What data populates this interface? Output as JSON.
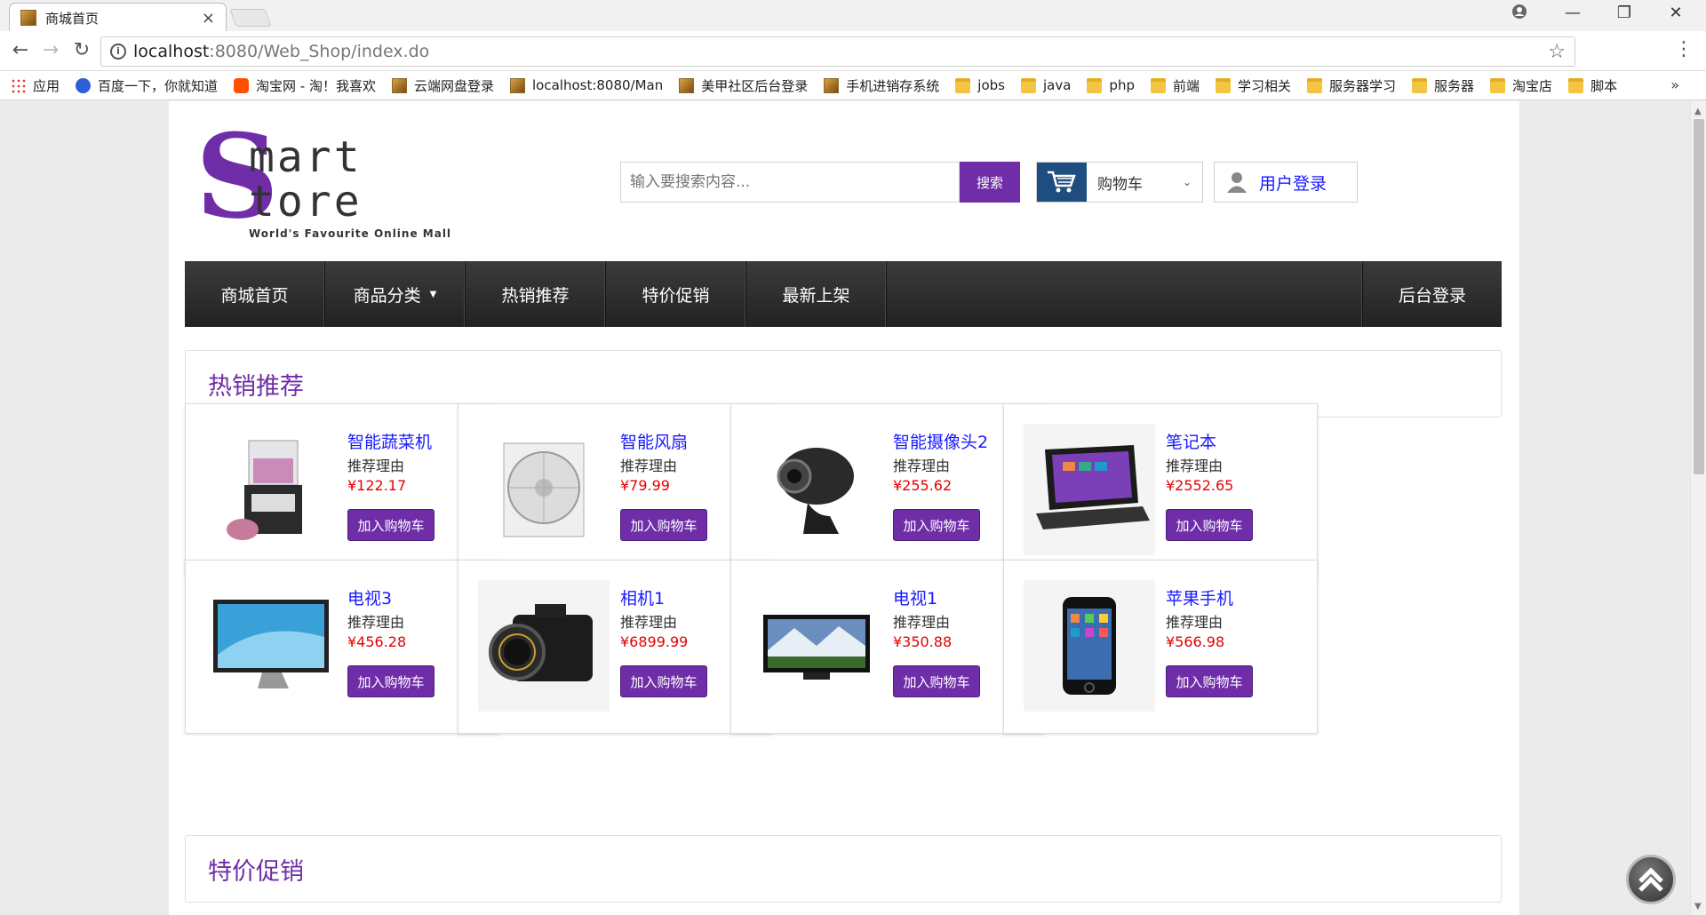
{
  "browser": {
    "tab_title": "商城首页",
    "tab_close": "×",
    "url_host": "localhost",
    "url_rest": ":8080/Web_Shop/index.do",
    "bookmarks": [
      {
        "label": "应用",
        "icon": "apps-icon"
      },
      {
        "label": "百度一下，你就知道",
        "icon": "baidu-icon"
      },
      {
        "label": "淘宝网 - 淘！我喜欢",
        "icon": "taobao-icon"
      },
      {
        "label": "云端网盘登录",
        "icon": "page-icon"
      },
      {
        "label": "localhost:8080/Man",
        "icon": "page-icon"
      },
      {
        "label": "美甲社区后台登录",
        "icon": "page-icon"
      },
      {
        "label": "手机进销存系统",
        "icon": "page-icon"
      },
      {
        "label": "jobs",
        "icon": "folder-icon"
      },
      {
        "label": "java",
        "icon": "folder-icon"
      },
      {
        "label": "php",
        "icon": "folder-icon"
      },
      {
        "label": "前端",
        "icon": "folder-icon"
      },
      {
        "label": "学习相关",
        "icon": "folder-icon"
      },
      {
        "label": "服务器学习",
        "icon": "folder-icon"
      },
      {
        "label": "服务器",
        "icon": "folder-icon"
      },
      {
        "label": "淘宝店",
        "icon": "folder-icon"
      },
      {
        "label": "脚本",
        "icon": "folder-icon"
      }
    ],
    "bookmarks_more": "»"
  },
  "header": {
    "logo_s": "S",
    "logo_line1": "mart",
    "logo_line2": "tore",
    "logo_tagline": "World's Favourite Online Mall",
    "search_placeholder": "输入要搜索内容...",
    "search_button": "搜索",
    "cart_label": "购物车",
    "login_label": "用户登录"
  },
  "nav": {
    "items": [
      "商城首页",
      "商品分类",
      "热销推荐",
      "特价促销",
      "最新上架"
    ],
    "right": "后台登录"
  },
  "sections": {
    "hot": "热销推荐",
    "sale": "特价促销"
  },
  "products": [
    {
      "name": "智能蔬菜机",
      "reason": "推荐理由",
      "price": "¥122.17",
      "button": "加入购物车",
      "img": "food-processor"
    },
    {
      "name": "智能风扇",
      "reason": "推荐理由",
      "price": "¥79.99",
      "button": "加入购物车",
      "img": "fan"
    },
    {
      "name": "智能摄像头2",
      "reason": "推荐理由",
      "price": "¥255.62",
      "button": "加入购物车",
      "img": "webcam"
    },
    {
      "name": "笔记本",
      "reason": "推荐理由",
      "price": "¥2552.65",
      "button": "加入购物车",
      "img": "laptop"
    },
    {
      "name": "电视3",
      "reason": "推荐理由",
      "price": "¥456.28",
      "button": "加入购物车",
      "img": "monitor"
    },
    {
      "name": "相机1",
      "reason": "推荐理由",
      "price": "¥6899.99",
      "button": "加入购物车",
      "img": "camera"
    },
    {
      "name": "电视1",
      "reason": "推荐理由",
      "price": "¥350.88",
      "button": "加入购物车",
      "img": "tv"
    },
    {
      "name": "苹果手机",
      "reason": "推荐理由",
      "price": "¥566.98",
      "button": "加入购物车",
      "img": "phone"
    }
  ],
  "colors": {
    "brand": "#6f2da8",
    "price": "#e60000",
    "link": "#1a1aff",
    "cart_icon_bg": "#1e4d7f"
  }
}
